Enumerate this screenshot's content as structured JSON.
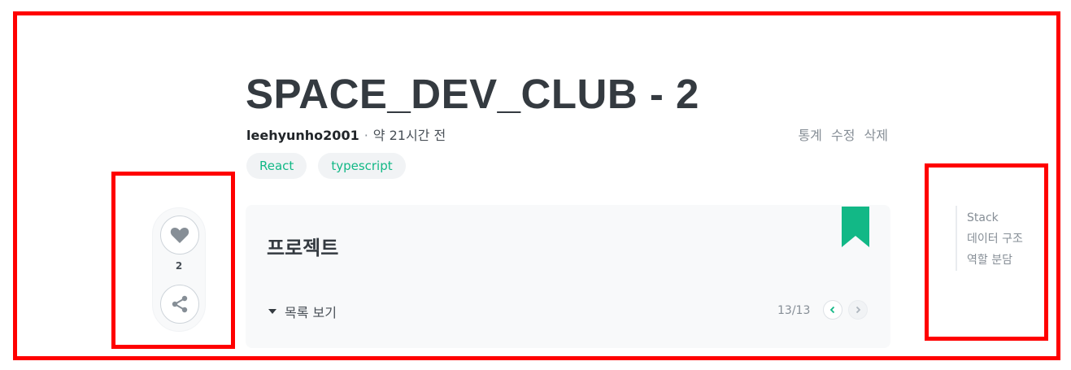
{
  "post": {
    "title": "SPACE_DEV_CLUB - 2",
    "author": "leehyunho2001",
    "separator": "·",
    "time": "약 21시간 전",
    "tags": [
      "React",
      "typescript"
    ],
    "actions": {
      "stats": "통계",
      "edit": "수정",
      "delete": "삭제"
    }
  },
  "sidebar": {
    "like_count": "2",
    "like_icon": "heart-icon",
    "share_icon": "share-icon"
  },
  "series": {
    "title": "프로젝트",
    "toc_label": "목록 보기",
    "page": "13/13",
    "bookmark_color": "#12b886"
  },
  "toc": {
    "items": [
      "Stack",
      "데이터 구조",
      "역할 분담"
    ]
  },
  "colors": {
    "accent": "#12b886",
    "annotation": "#ff0000"
  }
}
